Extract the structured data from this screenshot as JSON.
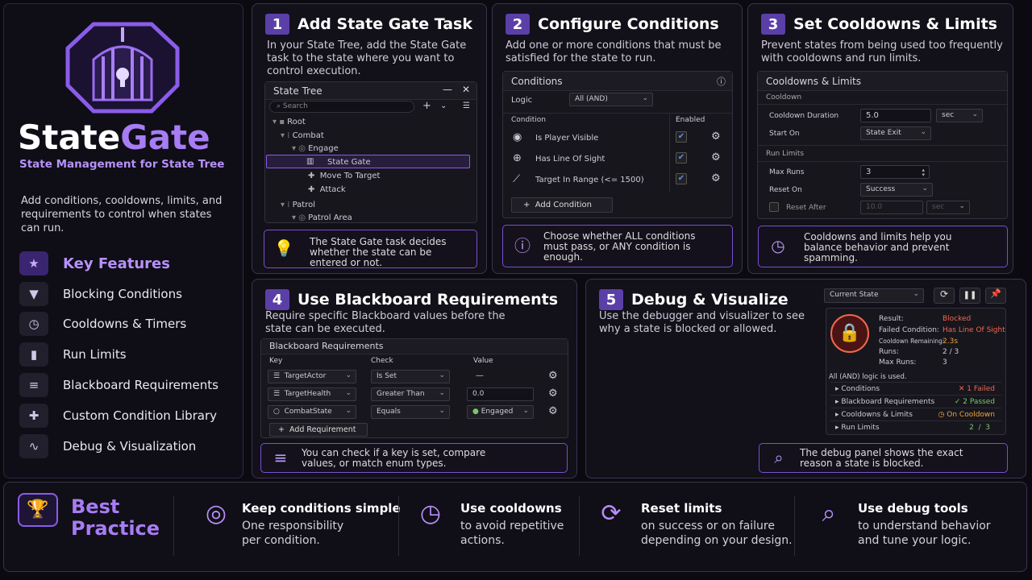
{
  "brand": {
    "name_a": "State",
    "name_b": "Gate",
    "subtitle": "State Management for State Tree",
    "description": "Add conditions, cooldowns, limits, and requirements to control when states can run."
  },
  "features": {
    "title": "Key Features",
    "items": [
      "Blocking Conditions",
      "Cooldowns & Timers",
      "Run Limits",
      "Blackboard Requirements",
      "Custom Condition Library",
      "Debug & Visualization"
    ]
  },
  "step1": {
    "num": "1",
    "title": "Add State Gate Task",
    "desc": "In your State Tree, add the State Gate task to the state where you want to control execution.",
    "window": {
      "title": "State Tree",
      "search": "Search",
      "nodes": [
        "Root",
        "Combat",
        "Engage",
        "State Gate",
        "Move To Target",
        "Attack",
        "Patrol",
        "Patrol Area"
      ]
    },
    "note": "The State Gate task decides whether the state can be entered or not."
  },
  "step2": {
    "num": "2",
    "title": "Configure Conditions",
    "desc": "Add one or more conditions that must be satisfied for the state to run.",
    "window": {
      "title": "Conditions",
      "logic_label": "Logic",
      "logic_value": "All (AND)",
      "col_condition": "Condition",
      "col_enabled": "Enabled",
      "conditions": [
        "Is Player Visible",
        "Has Line Of Sight",
        "Target In Range (<= 1500)"
      ],
      "add": "Add Condition"
    },
    "note": "Choose whether ALL conditions must pass, or ANY condition is enough."
  },
  "step3": {
    "num": "3",
    "title": "Set Cooldowns & Limits",
    "desc": "Prevent states from being used too frequently with cooldowns and run limits.",
    "window": {
      "title": "Cooldowns & Limits",
      "cooldown_section": "Cooldown",
      "duration_label": "Cooldown Duration",
      "duration_value": "5.0",
      "unit": "sec",
      "start_label": "Start On",
      "start_value": "State Exit",
      "runlimits_section": "Run Limits",
      "maxruns_label": "Max Runs",
      "maxruns_value": "3",
      "reset_label": "Reset On",
      "reset_value": "Success",
      "resetafter_label": "Reset After",
      "resetafter_value": "10.0",
      "resetafter_unit": "sec"
    },
    "note": "Cooldowns and limits help you balance behavior and prevent spamming."
  },
  "step4": {
    "num": "4",
    "title": "Use Blackboard Requirements",
    "desc": "Require specific Blackboard values before the state can be executed.",
    "window": {
      "title": "Blackboard Requirements",
      "col_key": "Key",
      "col_check": "Check",
      "col_value": "Value",
      "rows": [
        {
          "key": "TargetActor",
          "check": "Is Set",
          "value": "—"
        },
        {
          "key": "TargetHealth",
          "check": "Greater Than",
          "value": "0.0"
        },
        {
          "key": "CombatState",
          "check": "Equals",
          "value": "Engaged"
        }
      ],
      "add": "Add Requirement"
    },
    "note": "You can check if a key is set, compare values, or match enum types."
  },
  "step5": {
    "num": "5",
    "title": "Debug & Visualize",
    "desc": "Use the debugger and visualizer to see why a state is blocked or allowed.",
    "dropdown": "Current State",
    "result": {
      "result_label": "Result:",
      "result_value": "Blocked",
      "failed_label": "Failed Condition:",
      "failed_value": "Has Line Of Sight",
      "cooldown_label": "Cooldown Remaining:",
      "cooldown_value": "2.3s",
      "runs_label": "Runs:",
      "runs_value": "2 / 3",
      "maxruns_label": "Max Runs:",
      "maxruns_value": "3"
    },
    "logic_text": "All (AND) logic is used.",
    "rows": [
      {
        "label": "Conditions",
        "status": "✕ 1 Failed",
        "color": "#f2664f"
      },
      {
        "label": "Blackboard Requirements",
        "status": "✓ 2 Passed",
        "color": "#7bc86c"
      },
      {
        "label": "Cooldowns & Limits",
        "status": "◷ On Cooldown",
        "color": "#f0a53a"
      },
      {
        "label": "Run Limits",
        "status": "2  /  3",
        "color": "#7bc86c"
      }
    ],
    "note": "The debug panel shows the exact reason a state is blocked."
  },
  "best": {
    "title_a": "Best",
    "title_b": "Practice",
    "items": [
      {
        "title": "Keep conditions simple",
        "desc_a": "One responsibility",
        "desc_b": "per condition."
      },
      {
        "title": "Use cooldowns",
        "desc_a": "to avoid repetitive",
        "desc_b": "actions."
      },
      {
        "title": "Reset limits",
        "desc_a": "on success or on failure",
        "desc_b": "depending on your design."
      },
      {
        "title": "Use debug tools",
        "desc_a": "to understand behavior",
        "desc_b": "and tune your logic."
      }
    ]
  },
  "colors": {
    "accent": "#9b6cf0",
    "panel_border": "#3a3450",
    "failed": "#f2664f",
    "passed": "#7bc86c",
    "cooldown": "#f0a53a"
  }
}
